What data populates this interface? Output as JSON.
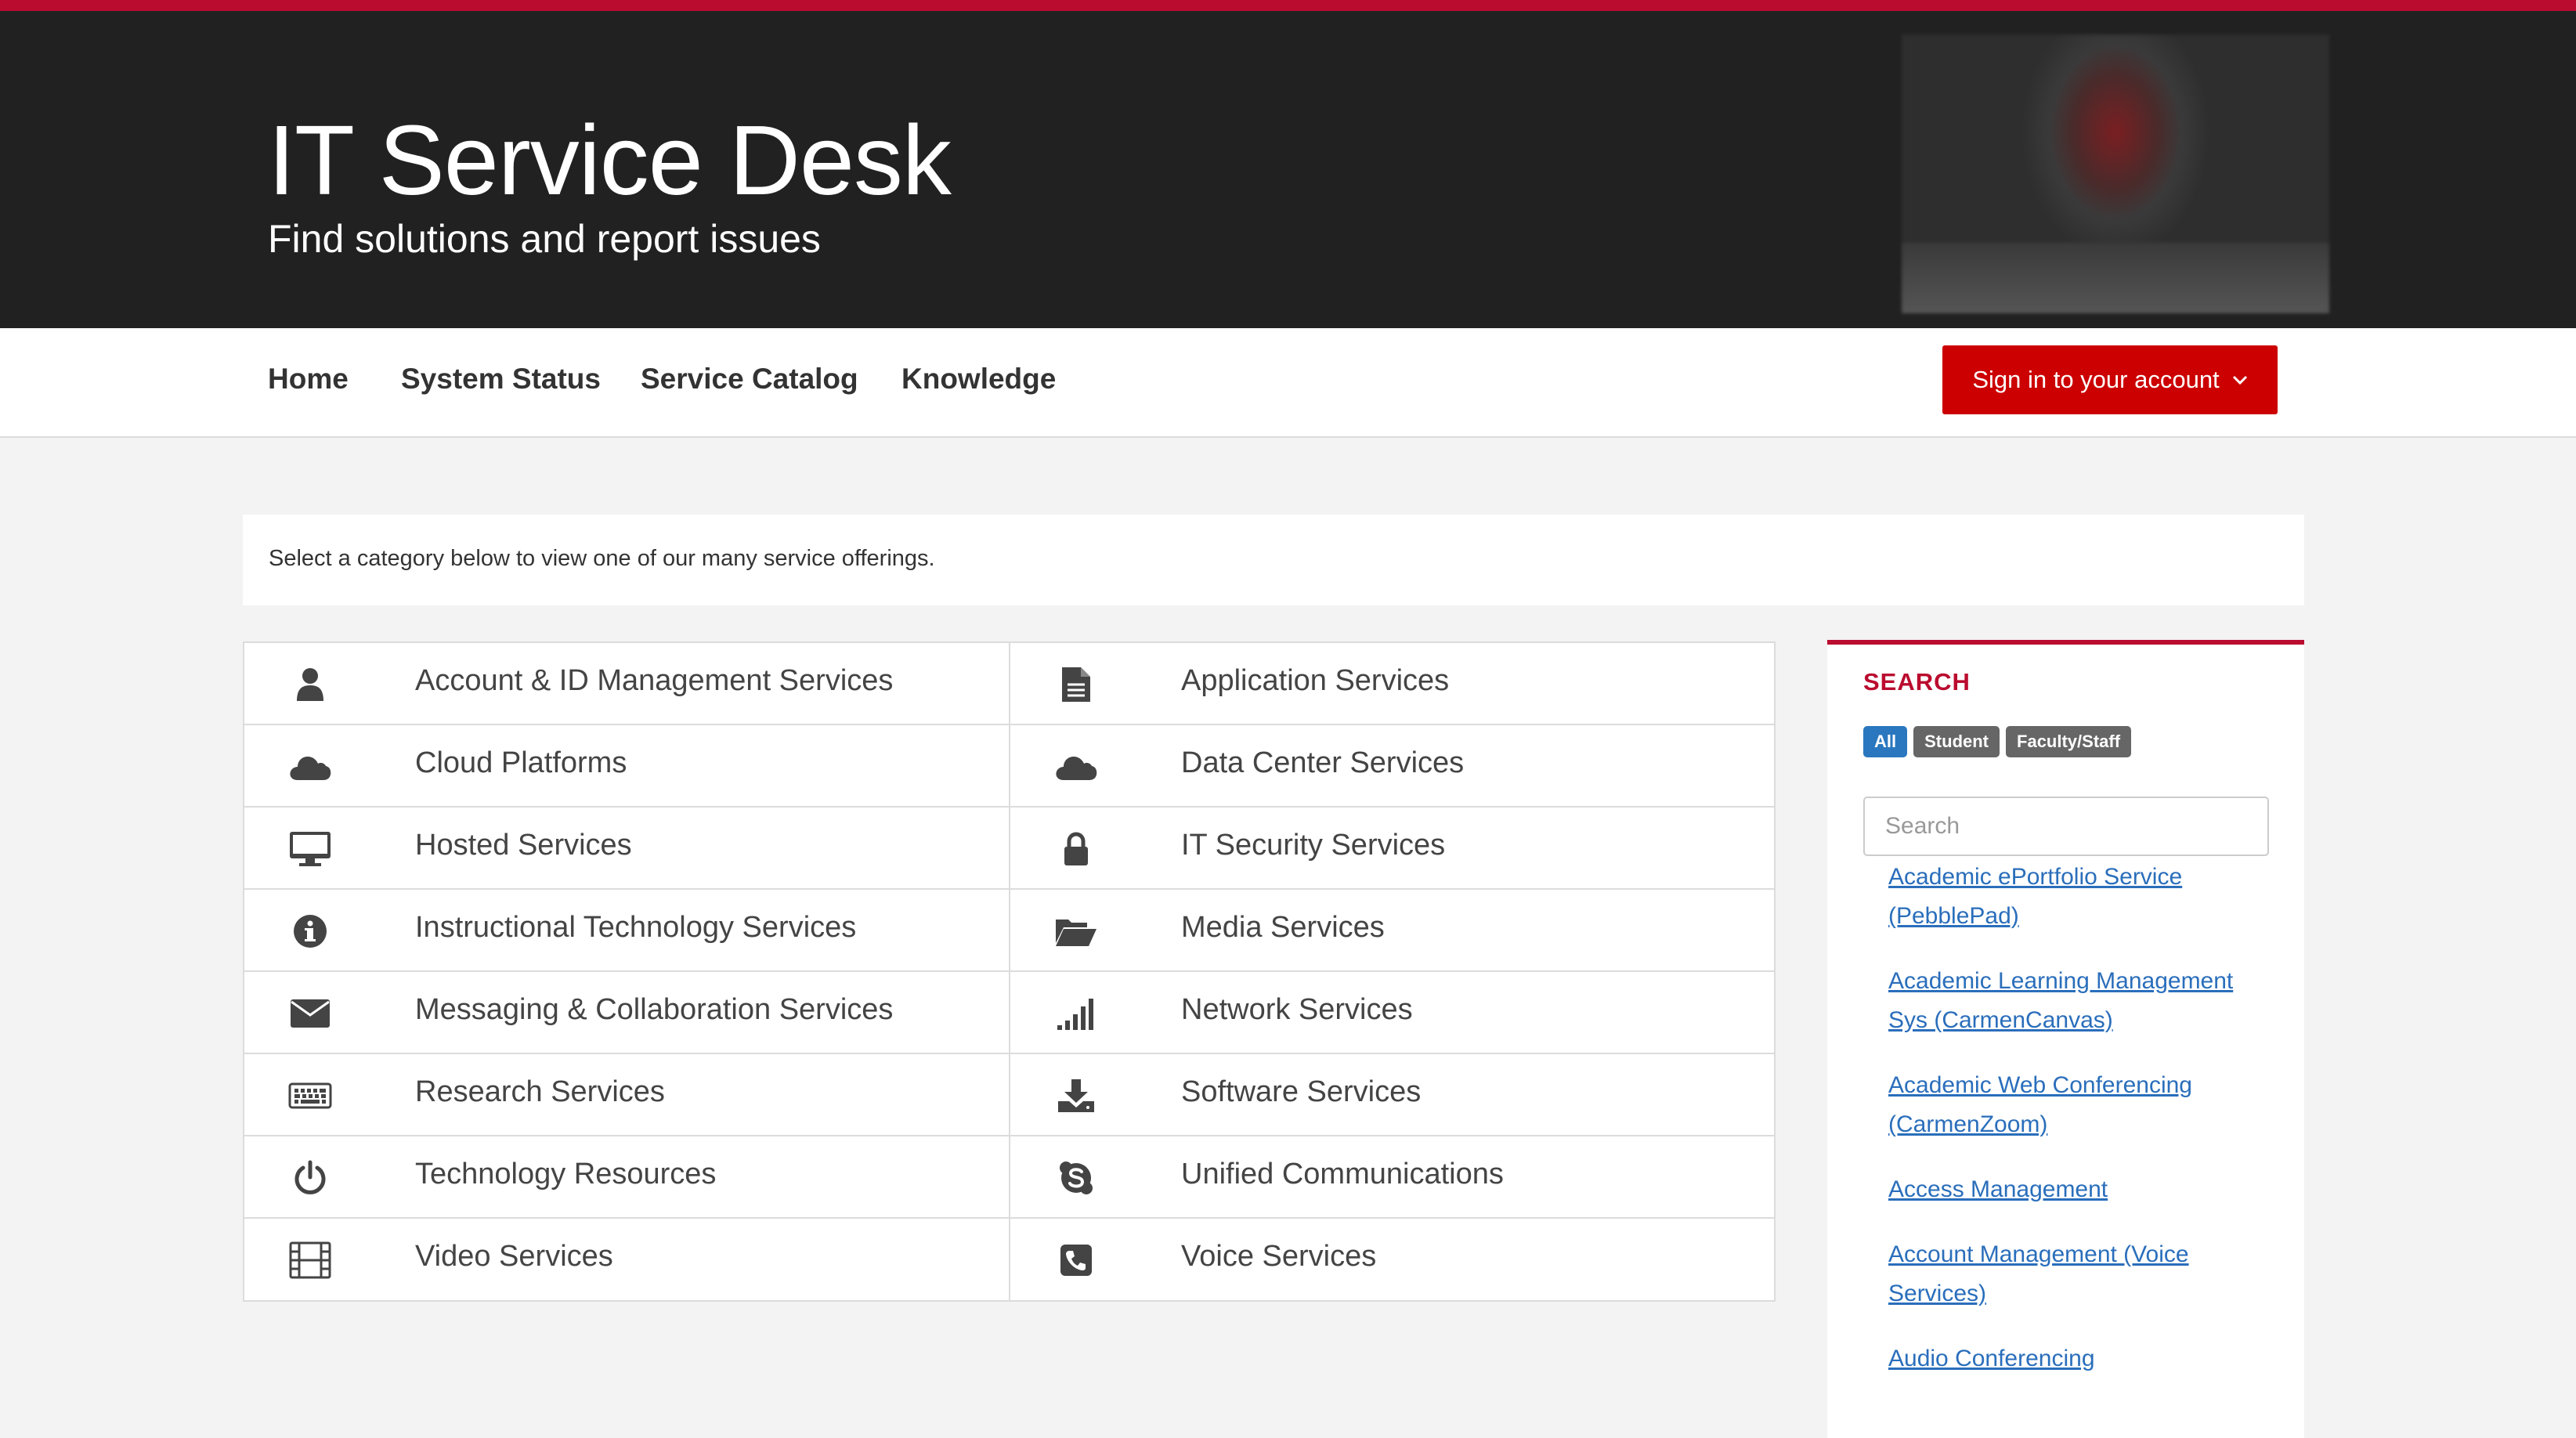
{
  "header": {
    "title": "IT Service Desk",
    "subtitle": "Find solutions and report issues"
  },
  "nav": {
    "items": [
      "Home",
      "System Status",
      "Service Catalog",
      "Knowledge"
    ],
    "signin_label": "Sign in to your account"
  },
  "intro": "Select a category below to view one of our many service offerings.",
  "categories": {
    "left": [
      {
        "label": "Account & ID Management Services",
        "icon": "user-icon"
      },
      {
        "label": "Cloud Platforms",
        "icon": "cloud-icon"
      },
      {
        "label": "Hosted Services",
        "icon": "desktop-icon"
      },
      {
        "label": "Instructional Technology Services",
        "icon": "info-icon"
      },
      {
        "label": "Messaging & Collaboration Services",
        "icon": "envelope-icon"
      },
      {
        "label": "Research Services",
        "icon": "keyboard-icon"
      },
      {
        "label": "Technology Resources",
        "icon": "power-icon"
      },
      {
        "label": "Video Services",
        "icon": "film-icon"
      }
    ],
    "right": [
      {
        "label": "Application Services",
        "icon": "document-icon"
      },
      {
        "label": "Data Center Services",
        "icon": "cloud-icon"
      },
      {
        "label": "IT Security Services",
        "icon": "lock-icon"
      },
      {
        "label": "Media Services",
        "icon": "folder-open-icon"
      },
      {
        "label": "Network Services",
        "icon": "signal-icon"
      },
      {
        "label": "Software Services",
        "icon": "download-icon"
      },
      {
        "label": "Unified Communications",
        "icon": "skype-icon"
      },
      {
        "label": "Voice Services",
        "icon": "phone-icon"
      }
    ]
  },
  "search": {
    "title": "SEARCH",
    "filters": [
      "All",
      "Student",
      "Faculty/Staff"
    ],
    "active_filter": "All",
    "placeholder": "Search",
    "value": "",
    "results": [
      "Academic ePortfolio Service (PebblePad)",
      "Academic Learning Management Sys (CarmenCanvas)",
      "Academic Web Conferencing (CarmenZoom)",
      "Access Management",
      "Account Management (Voice Services)",
      "Audio Conferencing"
    ]
  },
  "colors": {
    "brand_red": "#ba0c2f",
    "header_bg": "#212121",
    "link_blue": "#2a6ebb",
    "pill_active": "#2a77bf"
  }
}
